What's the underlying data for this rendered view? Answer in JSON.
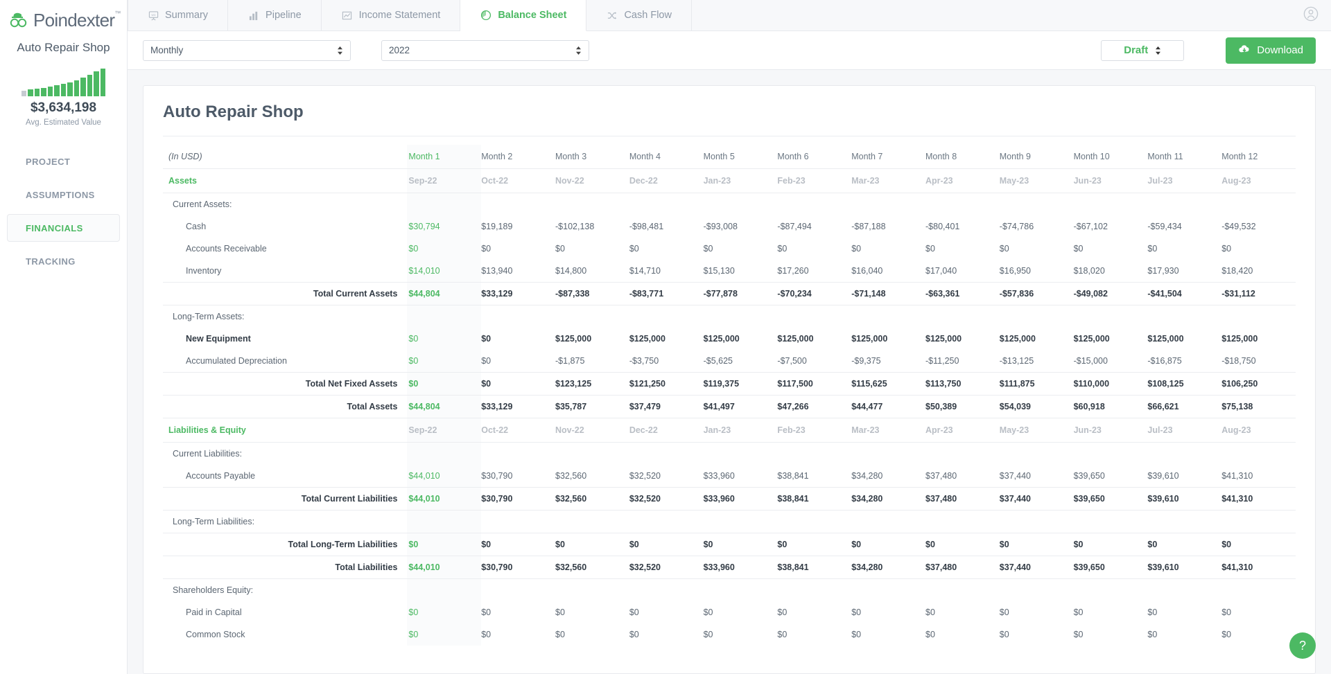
{
  "brand": {
    "name": "Poindexter",
    "tm": "™"
  },
  "sidebar": {
    "company": "Auto Repair Shop",
    "value_amount": "$3,634,198",
    "value_label": "Avg. Estimated Value",
    "sparkline": [
      8,
      10,
      11,
      12,
      14,
      16,
      18,
      20,
      23,
      27,
      31,
      36,
      40
    ],
    "items": [
      {
        "label": "PROJECT",
        "active": false
      },
      {
        "label": "ASSUMPTIONS",
        "active": false
      },
      {
        "label": "FINANCIALS",
        "active": true
      },
      {
        "label": "TRACKING",
        "active": false
      }
    ]
  },
  "tabs": [
    {
      "label": "Summary",
      "icon": "presentation-icon",
      "active": false
    },
    {
      "label": "Pipeline",
      "icon": "bar-chart-icon",
      "active": false
    },
    {
      "label": "Income Statement",
      "icon": "line-chart-icon",
      "active": false
    },
    {
      "label": "Balance Sheet",
      "icon": "pie-chart-icon",
      "active": true
    },
    {
      "label": "Cash Flow",
      "icon": "shuffle-icon",
      "active": false
    }
  ],
  "toolbar": {
    "period": "Monthly",
    "year": "2022",
    "status": "Draft",
    "download_label": "Download",
    "download_icon": "cloud-download-icon",
    "account_icon": "user-circle-icon"
  },
  "help": {
    "label": "?",
    "icon": "question-mark-icon"
  },
  "report": {
    "title": "Auto Repair Shop",
    "units_label": "(In USD)",
    "months": [
      "Month 1",
      "Month 2",
      "Month 3",
      "Month 4",
      "Month 5",
      "Month 6",
      "Month 7",
      "Month 8",
      "Month 9",
      "Month 10",
      "Month 11",
      "Month 12"
    ],
    "dates": [
      "Sep-22",
      "Oct-22",
      "Nov-22",
      "Dec-22",
      "Jan-23",
      "Feb-23",
      "Mar-23",
      "Apr-23",
      "May-23",
      "Jun-23",
      "Jul-23",
      "Aug-23"
    ],
    "rows": [
      {
        "type": "section",
        "label": "Assets",
        "values": [
          "Sep-22",
          "Oct-22",
          "Nov-22",
          "Dec-22",
          "Jan-23",
          "Feb-23",
          "Mar-23",
          "Apr-23",
          "May-23",
          "Jun-23",
          "Jul-23",
          "Aug-23"
        ]
      },
      {
        "type": "sub",
        "label": "Current Assets:",
        "values": [
          "",
          "",
          "",
          "",
          "",
          "",
          "",
          "",
          "",
          "",
          "",
          ""
        ]
      },
      {
        "type": "item",
        "label": "Cash",
        "values": [
          "$30,794",
          "$19,189",
          "-$102,138",
          "-$98,481",
          "-$93,008",
          "-$87,494",
          "-$87,188",
          "-$80,401",
          "-$74,786",
          "-$67,102",
          "-$59,434",
          "-$49,532"
        ]
      },
      {
        "type": "item",
        "label": "Accounts Receivable",
        "values": [
          "$0",
          "$0",
          "$0",
          "$0",
          "$0",
          "$0",
          "$0",
          "$0",
          "$0",
          "$0",
          "$0",
          "$0"
        ]
      },
      {
        "type": "item",
        "label": "Inventory",
        "values": [
          "$14,010",
          "$13,940",
          "$14,800",
          "$14,710",
          "$15,130",
          "$17,260",
          "$16,040",
          "$17,040",
          "$16,950",
          "$18,020",
          "$17,930",
          "$18,420"
        ]
      },
      {
        "type": "total",
        "label": "Total Current Assets",
        "values": [
          "$44,804",
          "$33,129",
          "-$87,338",
          "-$83,771",
          "-$77,878",
          "-$70,234",
          "-$71,148",
          "-$63,361",
          "-$57,836",
          "-$49,082",
          "-$41,504",
          "-$31,112"
        ]
      },
      {
        "type": "sub",
        "label": "Long-Term Assets:",
        "values": [
          "",
          "",
          "",
          "",
          "",
          "",
          "",
          "",
          "",
          "",
          "",
          ""
        ]
      },
      {
        "type": "item-strong",
        "label": "New Equipment",
        "values": [
          "$0",
          "$0",
          "$125,000",
          "$125,000",
          "$125,000",
          "$125,000",
          "$125,000",
          "$125,000",
          "$125,000",
          "$125,000",
          "$125,000",
          "$125,000"
        ]
      },
      {
        "type": "item",
        "label": "Accumulated Depreciation",
        "values": [
          "$0",
          "$0",
          "-$1,875",
          "-$3,750",
          "-$5,625",
          "-$7,500",
          "-$9,375",
          "-$11,250",
          "-$13,125",
          "-$15,000",
          "-$16,875",
          "-$18,750"
        ]
      },
      {
        "type": "total",
        "label": "Total Net Fixed Assets",
        "values": [
          "$0",
          "$0",
          "$123,125",
          "$121,250",
          "$119,375",
          "$117,500",
          "$115,625",
          "$113,750",
          "$111,875",
          "$110,000",
          "$108,125",
          "$106,250"
        ]
      },
      {
        "type": "total",
        "label": "Total Assets",
        "values": [
          "$44,804",
          "$33,129",
          "$35,787",
          "$37,479",
          "$41,497",
          "$47,266",
          "$44,477",
          "$50,389",
          "$54,039",
          "$60,918",
          "$66,621",
          "$75,138"
        ]
      },
      {
        "type": "section",
        "label": "Liabilities & Equity",
        "values": [
          "Sep-22",
          "Oct-22",
          "Nov-22",
          "Dec-22",
          "Jan-23",
          "Feb-23",
          "Mar-23",
          "Apr-23",
          "May-23",
          "Jun-23",
          "Jul-23",
          "Aug-23"
        ]
      },
      {
        "type": "sub",
        "label": "Current Liabilities:",
        "values": [
          "",
          "",
          "",
          "",
          "",
          "",
          "",
          "",
          "",
          "",
          "",
          ""
        ]
      },
      {
        "type": "item",
        "label": "Accounts Payable",
        "values": [
          "$44,010",
          "$30,790",
          "$32,560",
          "$32,520",
          "$33,960",
          "$38,841",
          "$34,280",
          "$37,480",
          "$37,440",
          "$39,650",
          "$39,610",
          "$41,310"
        ]
      },
      {
        "type": "total",
        "label": "Total Current Liabilities",
        "values": [
          "$44,010",
          "$30,790",
          "$32,560",
          "$32,520",
          "$33,960",
          "$38,841",
          "$34,280",
          "$37,480",
          "$37,440",
          "$39,650",
          "$39,610",
          "$41,310"
        ]
      },
      {
        "type": "sub",
        "label": "Long-Term Liabilities:",
        "values": [
          "",
          "",
          "",
          "",
          "",
          "",
          "",
          "",
          "",
          "",
          "",
          ""
        ]
      },
      {
        "type": "total",
        "label": "Total Long-Term Liabilities",
        "values": [
          "$0",
          "$0",
          "$0",
          "$0",
          "$0",
          "$0",
          "$0",
          "$0",
          "$0",
          "$0",
          "$0",
          "$0"
        ]
      },
      {
        "type": "total",
        "label": "Total Liabilities",
        "values": [
          "$44,010",
          "$30,790",
          "$32,560",
          "$32,520",
          "$33,960",
          "$38,841",
          "$34,280",
          "$37,480",
          "$37,440",
          "$39,650",
          "$39,610",
          "$41,310"
        ]
      },
      {
        "type": "sub",
        "label": "Shareholders Equity:",
        "values": [
          "",
          "",
          "",
          "",
          "",
          "",
          "",
          "",
          "",
          "",
          "",
          ""
        ]
      },
      {
        "type": "item",
        "label": "Paid in Capital",
        "values": [
          "$0",
          "$0",
          "$0",
          "$0",
          "$0",
          "$0",
          "$0",
          "$0",
          "$0",
          "$0",
          "$0",
          "$0"
        ]
      },
      {
        "type": "item",
        "label": "Common Stock",
        "values": [
          "$0",
          "$0",
          "$0",
          "$0",
          "$0",
          "$0",
          "$0",
          "$0",
          "$0",
          "$0",
          "$0",
          "$0"
        ]
      }
    ]
  },
  "colors": {
    "accent": "#4cb963",
    "text": "#5b6672",
    "muted": "#8d98a6"
  }
}
